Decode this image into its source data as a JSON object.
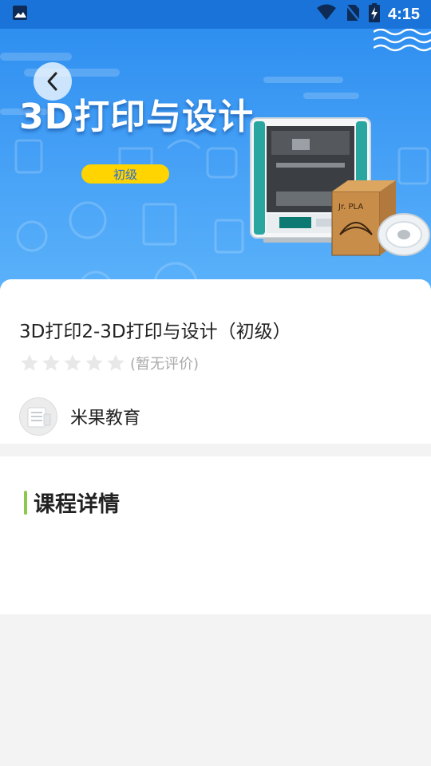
{
  "status_bar": {
    "time": "4:15",
    "icons": [
      "image-icon",
      "wifi-icon",
      "no-sim-icon",
      "battery-charging-icon"
    ]
  },
  "banner": {
    "title": "3D打印与设计",
    "level_badge": "初级",
    "product_box_label": "Jr. PLA"
  },
  "course": {
    "title": "3D打印2-3D打印与设计（初级）",
    "rating_text": "(暂无评价)",
    "stars": 5,
    "rating_value": 0
  },
  "provider": {
    "name": "米果教育"
  },
  "details": {
    "title": "课程详情"
  },
  "colors": {
    "status_bar": "#1a73d9",
    "banner": "#3a98f3",
    "badge": "#ffd400",
    "accent": "#8cc84b"
  }
}
